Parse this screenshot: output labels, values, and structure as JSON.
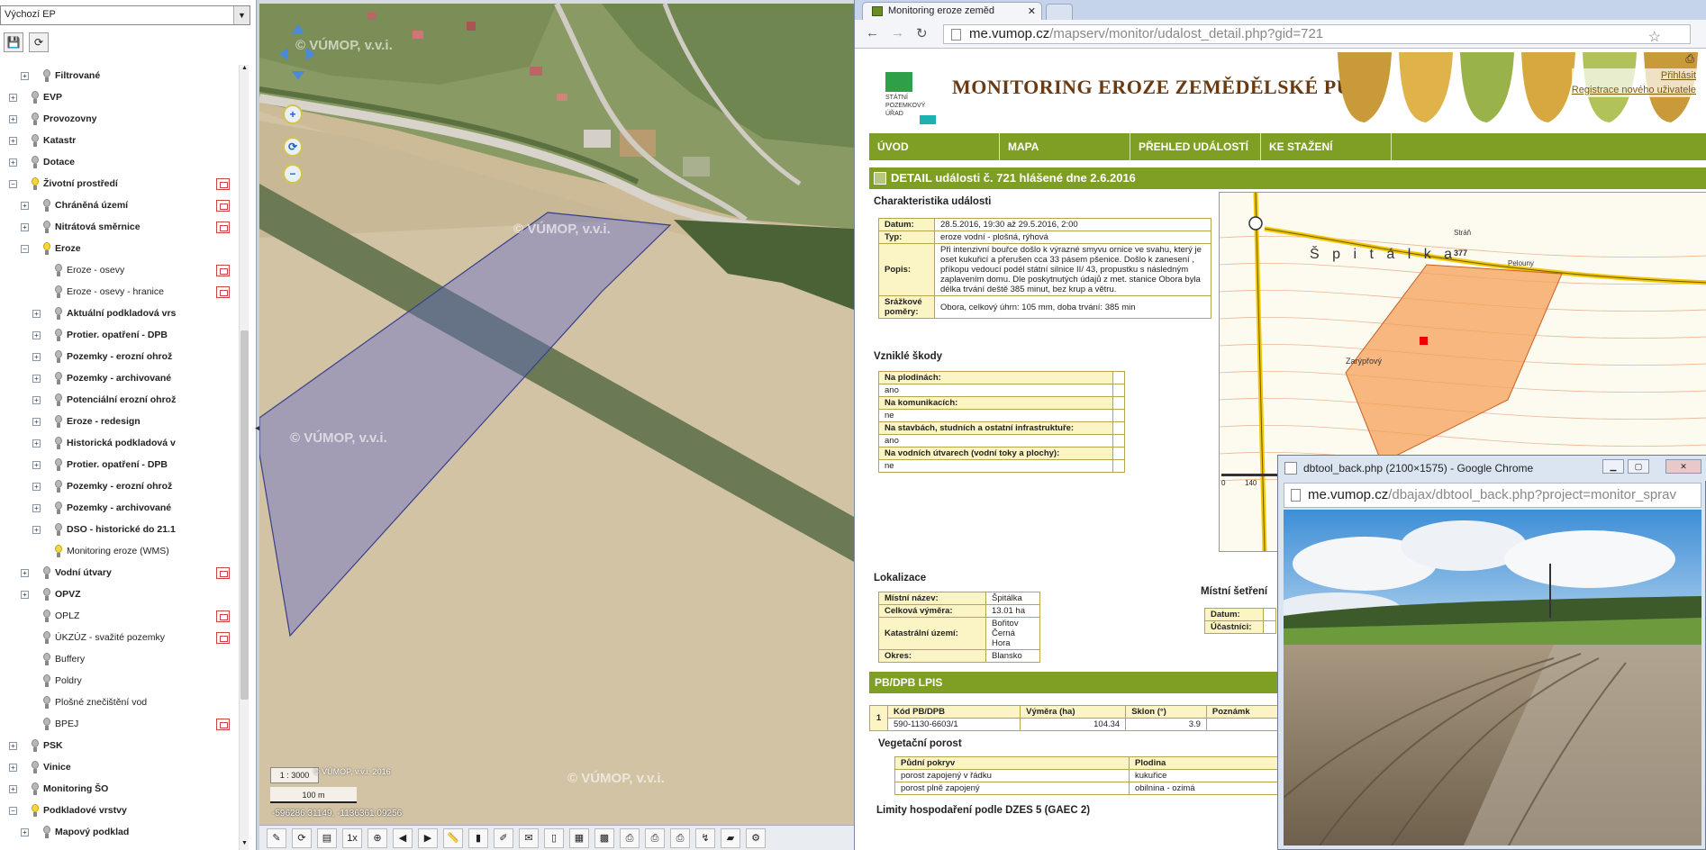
{
  "left_panel": {
    "ep_select_value": "Výchozí EP",
    "tree": [
      {
        "label": "Filtrované",
        "indent": 1,
        "bold": true,
        "on": false,
        "legend": false,
        "expander": true
      },
      {
        "label": "EVP",
        "indent": 0,
        "bold": true,
        "on": false,
        "legend": false,
        "expander": true
      },
      {
        "label": "Provozovny",
        "indent": 0,
        "bold": true,
        "on": false,
        "legend": false,
        "expander": true
      },
      {
        "label": "Katastr",
        "indent": 0,
        "bold": true,
        "on": false,
        "legend": false,
        "expander": true
      },
      {
        "label": "Dotace",
        "indent": 0,
        "bold": true,
        "on": false,
        "legend": false,
        "expander": true
      },
      {
        "label": "Životní prostředí",
        "indent": 0,
        "bold": true,
        "on": true,
        "legend": true,
        "expander": true,
        "expanded": true
      },
      {
        "label": "Chráněná území",
        "indent": 1,
        "bold": true,
        "on": false,
        "legend": true,
        "expander": true
      },
      {
        "label": "Nitrátová směrnice",
        "indent": 1,
        "bold": true,
        "on": false,
        "legend": true,
        "expander": true
      },
      {
        "label": "Eroze",
        "indent": 1,
        "bold": true,
        "on": true,
        "legend": false,
        "expander": true,
        "expanded": true
      },
      {
        "label": "Eroze - osevy",
        "indent": 2,
        "bold": false,
        "on": false,
        "legend": true,
        "expander": false
      },
      {
        "label": "Eroze - osevy - hranice",
        "indent": 2,
        "bold": false,
        "on": false,
        "legend": true,
        "expander": false
      },
      {
        "label": "Aktuální podkladová vrs",
        "indent": 2,
        "bold": true,
        "on": false,
        "legend": false,
        "expander": true
      },
      {
        "label": "Protier. opatření - DPB",
        "indent": 2,
        "bold": true,
        "on": false,
        "legend": false,
        "expander": true
      },
      {
        "label": "Pozemky - erozní ohrož",
        "indent": 2,
        "bold": true,
        "on": false,
        "legend": false,
        "expander": true
      },
      {
        "label": "Pozemky - archivované",
        "indent": 2,
        "bold": true,
        "on": false,
        "legend": false,
        "expander": true
      },
      {
        "label": "Potenciální erozní ohrož",
        "indent": 2,
        "bold": true,
        "on": false,
        "legend": false,
        "expander": true
      },
      {
        "label": "Eroze - redesign",
        "indent": 2,
        "bold": true,
        "on": false,
        "legend": false,
        "expander": true
      },
      {
        "label": "Historická podkladová v",
        "indent": 2,
        "bold": true,
        "on": false,
        "legend": false,
        "expander": true
      },
      {
        "label": "Protier. opatření - DPB",
        "indent": 2,
        "bold": true,
        "on": false,
        "legend": false,
        "expander": true
      },
      {
        "label": "Pozemky - erozní ohrož",
        "indent": 2,
        "bold": true,
        "on": false,
        "legend": false,
        "expander": true
      },
      {
        "label": "Pozemky - archivované",
        "indent": 2,
        "bold": true,
        "on": false,
        "legend": false,
        "expander": true
      },
      {
        "label": "DSO - historické do 21.1",
        "indent": 2,
        "bold": true,
        "on": false,
        "legend": false,
        "expander": true
      },
      {
        "label": "Monitoring eroze (WMS)",
        "indent": 2,
        "bold": false,
        "on": true,
        "legend": false,
        "expander": false
      },
      {
        "label": "Vodní útvary",
        "indent": 1,
        "bold": true,
        "on": false,
        "legend": true,
        "expander": true
      },
      {
        "label": "OPVZ",
        "indent": 1,
        "bold": true,
        "on": false,
        "legend": false,
        "expander": true
      },
      {
        "label": "OPLZ",
        "indent": 1,
        "bold": false,
        "on": false,
        "legend": true,
        "expander": false
      },
      {
        "label": "ÚKZÚZ - svažité pozemky",
        "indent": 1,
        "bold": false,
        "on": false,
        "legend": true,
        "expander": false
      },
      {
        "label": "Buffery",
        "indent": 1,
        "bold": false,
        "on": false,
        "legend": false,
        "expander": false
      },
      {
        "label": "Poldry",
        "indent": 1,
        "bold": false,
        "on": false,
        "legend": false,
        "expander": false
      },
      {
        "label": "Plošné znečištění vod",
        "indent": 1,
        "bold": false,
        "on": false,
        "legend": false,
        "expander": false
      },
      {
        "label": "BPEJ",
        "indent": 1,
        "bold": false,
        "on": false,
        "legend": true,
        "expander": false
      },
      {
        "label": "PSK",
        "indent": 0,
        "bold": true,
        "on": false,
        "legend": false,
        "expander": true
      },
      {
        "label": "Vinice",
        "indent": 0,
        "bold": true,
        "on": false,
        "legend": false,
        "expander": true
      },
      {
        "label": "Monitoring ŠO",
        "indent": 0,
        "bold": true,
        "on": false,
        "legend": false,
        "expander": true
      },
      {
        "label": "Podkladové vrstvy",
        "indent": 0,
        "bold": true,
        "on": true,
        "legend": false,
        "expander": true,
        "expanded": true
      },
      {
        "label": "Mapový podklad",
        "indent": 1,
        "bold": true,
        "on": false,
        "legend": false,
        "expander": true
      }
    ]
  },
  "map": {
    "watermark": "© VÚMOP, v.v.i.",
    "scale_text": "1 : 3000",
    "scalebar_text": "100 m",
    "copyright": "© VÚMOP, v.v.i. 2016",
    "coords": "-596286.31149, -1136361.09256"
  },
  "browser": {
    "tab_title": "Monitoring eroze zeměd",
    "url_host": "me.vumop.cz",
    "url_path": "/mapserv/monitor/udalost_detail.php?gid=721",
    "logo_text": "STÁTNÍ POZEMKOVÝ ÚŘAD",
    "site_title": "MONITORING EROZE ZEMĚDĚLSKÉ PŮDY",
    "login_link": "Přihlásit",
    "register_link": "Registrace nového uživatele",
    "menu": [
      "ÚVOD",
      "MAPA",
      "PŘEHLED UDÁLOSTÍ",
      "KE STAŽENÍ"
    ],
    "detail_title": "DETAIL události č. 721   hlášené dne 2.6.2016",
    "char_heading": "Charakteristika události",
    "char_rows": [
      {
        "k": "Datum:",
        "v": "28.5.2016, 19:30 až 29.5.2016, 2:00"
      },
      {
        "k": "Typ:",
        "v": "eroze vodní - plošná, rýhová"
      },
      {
        "k": "Popis:",
        "v": "Při intenzivní bouřce došlo k výrazné smyvu ornice ve svahu, který je oset kukuřicí a přerušen cca 33 pásem pšenice. Došlo k zanesení , příkopu vedoucí podél státní silnice II/ 43, propustku s následným zaplavením domu. Dle poskytnutých údajů z met. stanice Obora byla délka trvání deště 385 minut, bez krup a větru."
      },
      {
        "k": "Srážkové poměry:",
        "v": "Obora, celkový úhrn: 105 mm, doba trvání: 385 min"
      }
    ],
    "damage_heading": "Vzniklé škody",
    "damage_rows": [
      {
        "k": "Na plodinách:",
        "v": "ano"
      },
      {
        "k": "Na komunikacích:",
        "v": "ne"
      },
      {
        "k": "Na stavbách, studních a ostatní infrastruktuře:",
        "v": "ano"
      },
      {
        "k": "Na vodních útvarech (vodní toky a plochy):",
        "v": "ne"
      }
    ],
    "map_labels": {
      "place": "Š p i t á l k a",
      "road": "377",
      "place2": "Zarýpřový",
      "place3": "Pelouny",
      "place4": "Stráň",
      "scale_left": "0",
      "scale_right": "140"
    },
    "loc_heading": "Lokalizace",
    "loc_rows": [
      {
        "k": "Místní název:",
        "v": "Špitálka"
      },
      {
        "k": "Celková výměra:",
        "v": "13.01 ha"
      },
      {
        "k": "Katastrální území:",
        "v": "Bořitov Černá Hora"
      },
      {
        "k": "Okres:",
        "v": "Blansko"
      }
    ],
    "survey_heading": "Místní šetření",
    "survey_rows": [
      {
        "k": "Datum:"
      },
      {
        "k": "Účastníci:"
      }
    ],
    "pb_heading": "PB/DPB LPIS",
    "pb_headers": [
      "Kód PB/DPB",
      "Výměra (ha)",
      "Sklon (°)",
      "Poznámk"
    ],
    "pb_row": {
      "n": "1",
      "code": "590-1130-6603/1",
      "area": "104.34",
      "slope": "3.9"
    },
    "veg_heading": "Vegetační porost",
    "veg_headers": [
      "Půdní pokryv",
      "Plodina"
    ],
    "veg_rows": [
      {
        "a": "porost zapojený v řádku",
        "b": "kukuřice"
      },
      {
        "a": "porost plně zapojený",
        "b": "obilnina - ozimá"
      }
    ],
    "limits_heading": "Limity hospodaření podle DZES 5 (GAEC 2)"
  },
  "popup": {
    "title": "dbtool_back.php (2100×1575) - Google Chrome",
    "url_host": "me.vumop.cz",
    "url_path": "/dbajax/dbtool_back.php?project=monitor_sprav"
  }
}
